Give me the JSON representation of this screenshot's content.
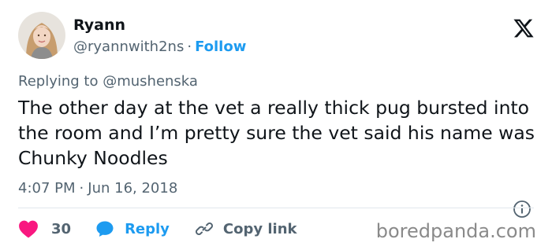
{
  "author": {
    "name": "Ryann",
    "handle": "@ryannwith2ns",
    "separator": "·",
    "follow_label": "Follow"
  },
  "reply": {
    "prefix": "Replying to",
    "mention": "@mushenska"
  },
  "tweet": {
    "text": "The other day at the vet a really thick pug bursted into the room and I’m pretty sure the vet said his name was Chunky Noodles",
    "time": "4:07 PM",
    "separator": "·",
    "date": "Jun 16, 2018"
  },
  "actions": {
    "like_count": "30",
    "reply_label": "Reply",
    "copy_label": "Copy link"
  },
  "watermark": "boredpanda.com",
  "colors": {
    "accent": "#1d9bf0",
    "heart": "#f91880",
    "secondary_text": "#536471",
    "primary_text": "#0f1419"
  },
  "icons": {
    "logo": "x-logo-icon",
    "info": "info-icon",
    "like": "heart-icon",
    "reply": "reply-bubble-icon",
    "copy": "link-icon"
  }
}
